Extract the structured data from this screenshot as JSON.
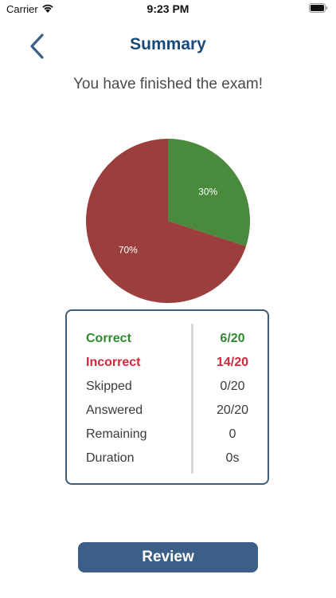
{
  "status_bar": {
    "carrier": "Carrier",
    "time": "9:23 PM"
  },
  "nav": {
    "title": "Summary",
    "title_color": "#184a7a"
  },
  "message": "You have finished the exam!",
  "chart_data": {
    "type": "pie",
    "title": "",
    "slices": [
      {
        "label": "30%",
        "value": 30,
        "color": "#4a8a3c"
      },
      {
        "label": "70%",
        "value": 70,
        "color": "#9c3e3e"
      }
    ]
  },
  "stats": [
    {
      "key": "correct",
      "label": "Correct",
      "value": "6/20",
      "color": "#2f8a2f"
    },
    {
      "key": "incorrect",
      "label": "Incorrect",
      "value": "14/20",
      "color": "#d0283c"
    },
    {
      "key": "skipped",
      "label": "Skipped",
      "value": "0/20"
    },
    {
      "key": "answered",
      "label": "Answered",
      "value": "20/20"
    },
    {
      "key": "remaining",
      "label": "Remaining",
      "value": "0"
    },
    {
      "key": "duration",
      "label": "Duration",
      "value": "0s"
    }
  ],
  "review_button": {
    "label": "Review",
    "color": "#3b5f87"
  },
  "icons": {
    "back": "chevron-left-icon",
    "wifi": "wifi-icon",
    "battery": "battery-icon"
  }
}
